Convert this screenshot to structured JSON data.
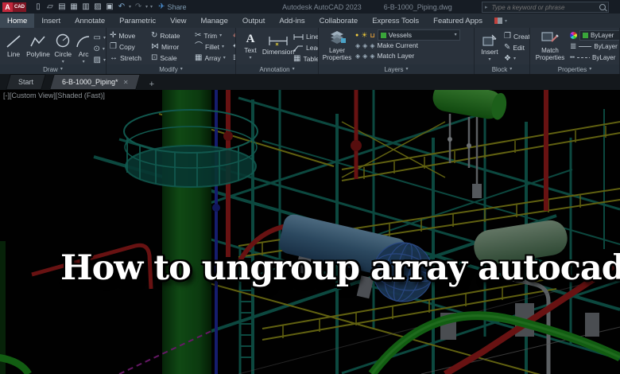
{
  "titlebar": {
    "logo_a": "A",
    "logo_cad": "CAD",
    "share_label": "Share",
    "app_title": "Autodesk AutoCAD 2023",
    "document_title": "6-B-1000_Piping.dwg",
    "search_placeholder": "Type a keyword or phrase"
  },
  "ribbon": {
    "tabs": [
      {
        "label": "Home",
        "active": true
      },
      {
        "label": "Insert",
        "active": false
      },
      {
        "label": "Annotate",
        "active": false
      },
      {
        "label": "Parametric",
        "active": false
      },
      {
        "label": "View",
        "active": false
      },
      {
        "label": "Manage",
        "active": false
      },
      {
        "label": "Output",
        "active": false
      },
      {
        "label": "Add-ins",
        "active": false
      },
      {
        "label": "Collaborate",
        "active": false
      },
      {
        "label": "Express Tools",
        "active": false
      },
      {
        "label": "Featured Apps",
        "active": false
      }
    ],
    "panels": {
      "draw": {
        "label": "Draw",
        "tools": [
          "Line",
          "Polyline",
          "Circle",
          "Arc"
        ]
      },
      "modify": {
        "label": "Modify",
        "tools": [
          "Move",
          "Copy",
          "Stretch",
          "Rotate",
          "Mirror",
          "Scale",
          "Trim",
          "Fillet",
          "Array"
        ]
      },
      "annotation": {
        "label": "Annotation",
        "tools": [
          "Text",
          "Dimension",
          "Linear",
          "Leader",
          "Table"
        ]
      },
      "layers": {
        "label": "Layers",
        "big_tool": "Layer Properties",
        "current_layer": "Vessels",
        "tools": [
          "Make Current",
          "Match Layer"
        ]
      },
      "block": {
        "label": "Block",
        "big_tool": "Insert",
        "tools": [
          "Create",
          "Edit"
        ]
      },
      "properties": {
        "label": "Properties",
        "big_tool": "Match Properties",
        "color": "ByLayer",
        "lineweight": "ByLayer",
        "linetype": "ByLayer"
      }
    }
  },
  "filetabs": {
    "start": "Start",
    "document": "6-B-1000_Piping*"
  },
  "viewport": {
    "controls": "[-][Custom View][Shaded (Fast)]",
    "overlay_title": "How to ungroup array autocad?"
  },
  "icons": {
    "chevron_down": "▾",
    "chevron_right": "▸",
    "close": "✕",
    "add": "+",
    "share_plane": "✈",
    "new_file": "▯",
    "open_folder": "▱",
    "save": "▤",
    "save_as": "▦",
    "plot": "▥",
    "export": "▨",
    "print": "▣",
    "undo": "↶",
    "redo": "↷",
    "move": "✛",
    "copy": "❐",
    "stretch": "↔",
    "rotate": "↻",
    "mirror": "⋈",
    "scale": "⊡",
    "trim": "✂",
    "fillet": "⌒",
    "array": "▦",
    "erase": "✐",
    "rect": "▭",
    "ellipse": "⊙",
    "hatch": "▨",
    "table": "▦",
    "bulb": "●",
    "sun": "☀",
    "unlock": "⊔",
    "diamond": "◈",
    "create": "❐",
    "edit": "✎",
    "pick": "❖",
    "lineweight": "≣",
    "linetype": "┅"
  },
  "colors": {
    "autocad_brand_red": "#c2283c",
    "ribbon_background": "#2a323c",
    "active_layer_green": "#3aa63a",
    "structure_teal": "#15786a",
    "railing_yellow": "#a2a21c",
    "pipe_red": "#ad1f1f",
    "pipe_green": "#1f9c1f",
    "pipe_blue": "#2431b8",
    "pipe_magenta": "#a928a9",
    "vessel_green": "#3aa432",
    "vessel_steel_blue": "#49799f",
    "vessel_pale_green": "#8fb694",
    "column_green": "#1b7a22"
  }
}
